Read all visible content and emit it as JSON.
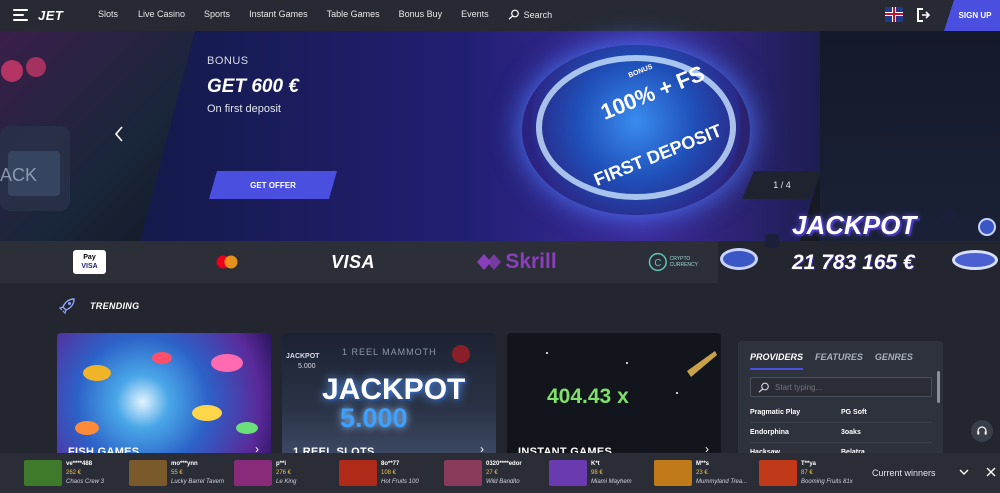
{
  "header": {
    "logo": "JET",
    "nav": [
      "Slots",
      "Live Casino",
      "Sports",
      "Instant Games",
      "Table Games",
      "Bonus Buy",
      "Events",
      "Search"
    ],
    "signup_label": "SIGN UP"
  },
  "hero": {
    "label": "BONUS",
    "amount": "GET 600 €",
    "subtitle": "On first deposit",
    "offer_button": "GET OFFER",
    "pager": "1 / 4",
    "coin_small": "BONUS",
    "coin_main": "100% + FS",
    "coin_ring": "FIRST DEPOSIT"
  },
  "payments": {
    "apple_pay": "Pay",
    "apple_visa": "VISA",
    "visa": "VISA",
    "skrill": "Skrill",
    "crypto_line1": "CRYPTO",
    "crypto_line2": "CURRENCY"
  },
  "jackpot": {
    "title": "JACKPOT",
    "value": "21 783 165 €"
  },
  "trending": {
    "title": "TRENDING",
    "cards": [
      {
        "title": "FISH GAMES"
      },
      {
        "title": "1 REEL SLOTS",
        "art_top": "1 REEL MAMMOTH",
        "art_jackpot": "JACKPOT",
        "art_value": "5.000",
        "art_small": "JACKPOT",
        "art_small_value": "5.000"
      },
      {
        "title": "INSTANT GAMES",
        "multiplier": "404.43 x"
      }
    ]
  },
  "providers": {
    "tabs": [
      "PROVIDERS",
      "FEATURES",
      "GENRES"
    ],
    "search_placeholder": "Start typing...",
    "rows": [
      [
        "Pragmatic Play",
        "PG Soft"
      ],
      [
        "Endorphina",
        "3oaks"
      ],
      [
        "Hacksaw",
        "Belatra"
      ]
    ]
  },
  "winners": {
    "label": "Current winners",
    "items": [
      {
        "name": "ve****488",
        "amount": "262 €",
        "game": "Chaos Crew 3",
        "color": "#3f7a2a"
      },
      {
        "name": "mo***ynn",
        "amount": "55 €",
        "game": "Lucky Barrel Tavern",
        "color": "#7a5a2a"
      },
      {
        "name": "p**i",
        "amount": "276 €",
        "game": "Le King",
        "color": "#8a2a7a"
      },
      {
        "name": "8o**77",
        "amount": "108 €",
        "game": "Hot Fruits 100",
        "color": "#b02a1a"
      },
      {
        "name": "0320****edor",
        "amount": "27 €",
        "game": "Wild Bandito",
        "color": "#8a3a5a"
      },
      {
        "name": "K*t",
        "amount": "98 €",
        "game": "Miami Mayhem",
        "color": "#6a3ab0"
      },
      {
        "name": "M**s",
        "amount": "23 €",
        "game": "Mummyland Trea...",
        "color": "#c07a1a"
      },
      {
        "name": "T**ya",
        "amount": "87 €",
        "game": "Booming Fruits 81x",
        "color": "#c03a1a"
      }
    ]
  }
}
